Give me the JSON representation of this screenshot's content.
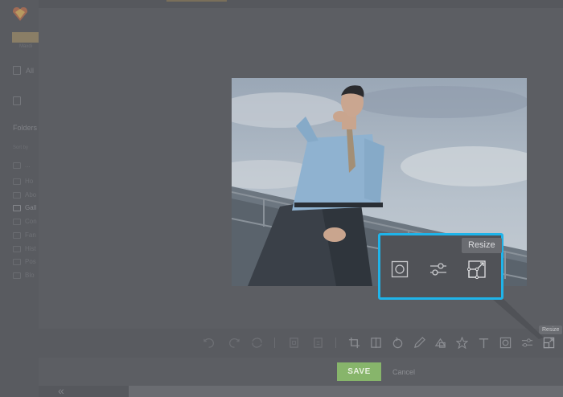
{
  "sidebar": {
    "logo_sub": "Maxdi",
    "nav": [
      {
        "label": "All",
        "icon": "file-icon"
      },
      {
        "label": "",
        "icon": "image-icon"
      }
    ],
    "folders_title": "Folders",
    "sort_by": "Sort by",
    "folders": [
      {
        "label": "...",
        "active": false
      },
      {
        "label": "Ho",
        "active": false
      },
      {
        "label": "Abo",
        "active": false
      },
      {
        "label": "Gall",
        "active": true
      },
      {
        "label": "Con",
        "active": false
      },
      {
        "label": "Fan",
        "active": false
      },
      {
        "label": "Hist",
        "active": false
      },
      {
        "label": "Pos",
        "active": false
      },
      {
        "label": "Blo",
        "active": false
      }
    ]
  },
  "toolbar": {
    "tools": [
      "undo-icon",
      "redo-icon",
      "reset-icon",
      "copy-icon",
      "paste-icon",
      "crop-icon",
      "flip-icon",
      "rotate-icon",
      "draw-icon",
      "shapes-icon",
      "sticker-icon",
      "text-icon",
      "frame-icon",
      "adjust-icon",
      "resize-icon"
    ],
    "save_label": "SAVE",
    "cancel_label": "Cancel",
    "resize_tooltip": "Resize"
  },
  "callout": {
    "tooltip": "Resize",
    "icons": [
      "frame-icon",
      "adjust-icon",
      "resize-icon"
    ]
  },
  "colors": {
    "accent": "#1fb4ea",
    "save": "#87b56b"
  }
}
